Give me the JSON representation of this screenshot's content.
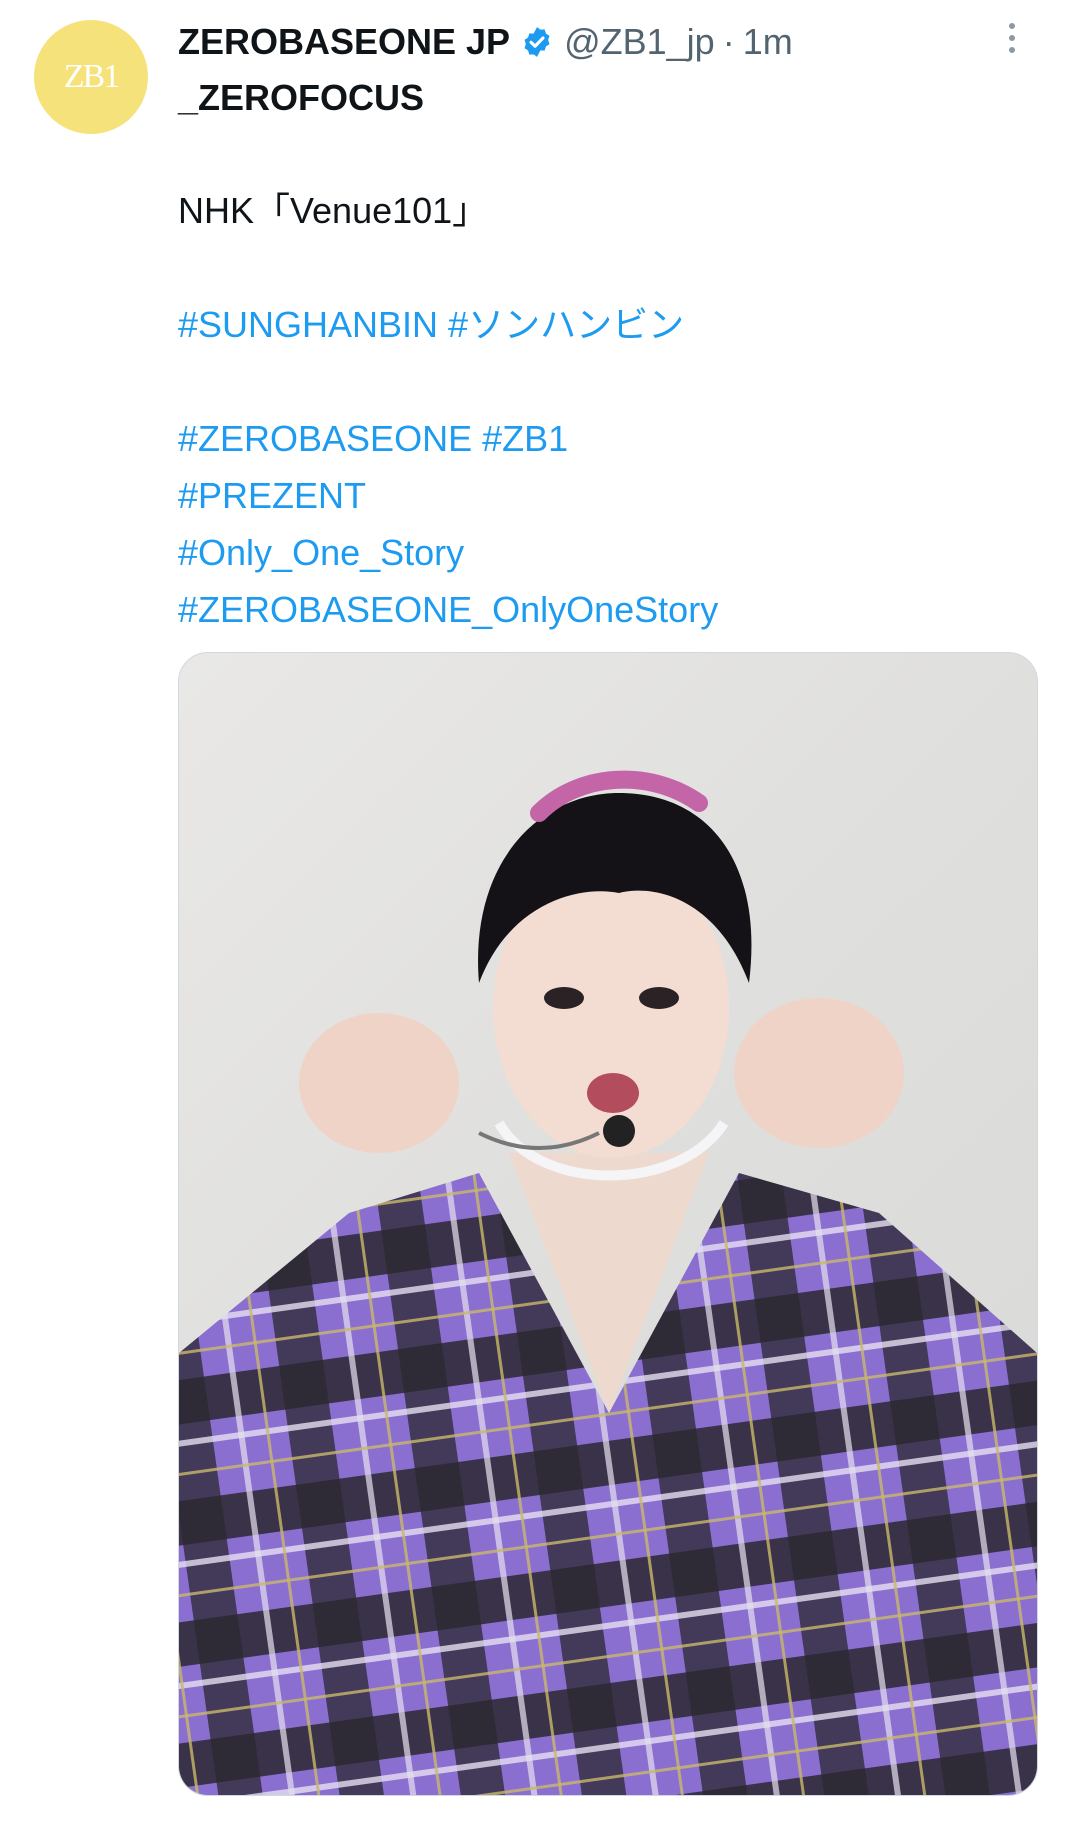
{
  "account": {
    "avatar_text": "ZB1",
    "display_name": "ZEROBASEONE JP",
    "display_name_cont": "_ZEROFOCUS",
    "handle": "@ZB1_jp",
    "separator": "·",
    "time": "1m",
    "verified_icon": "verified-badge-icon",
    "avatar_color": "#f6e27a"
  },
  "tweet": {
    "line1": "NHK「Venue101」",
    "hashtags_row1": "#SUNGHANBIN #ソンハンビン",
    "hashtags_row2": "#ZEROBASEONE #ZB1",
    "hashtags_row3": "#PREZENT",
    "hashtags_row4": "#Only_One_Story",
    "hashtags_row5": "#ZEROBASEONE_OnlyOneStory"
  },
  "colors": {
    "link": "#1d9bf0",
    "text": "#0f1419",
    "muted": "#536471",
    "shirt_purple": "#8a6fd1",
    "shirt_black": "#1f1d24"
  },
  "media": {
    "icon": "photo-icon"
  },
  "menu": {
    "icon": "more-options-icon"
  }
}
